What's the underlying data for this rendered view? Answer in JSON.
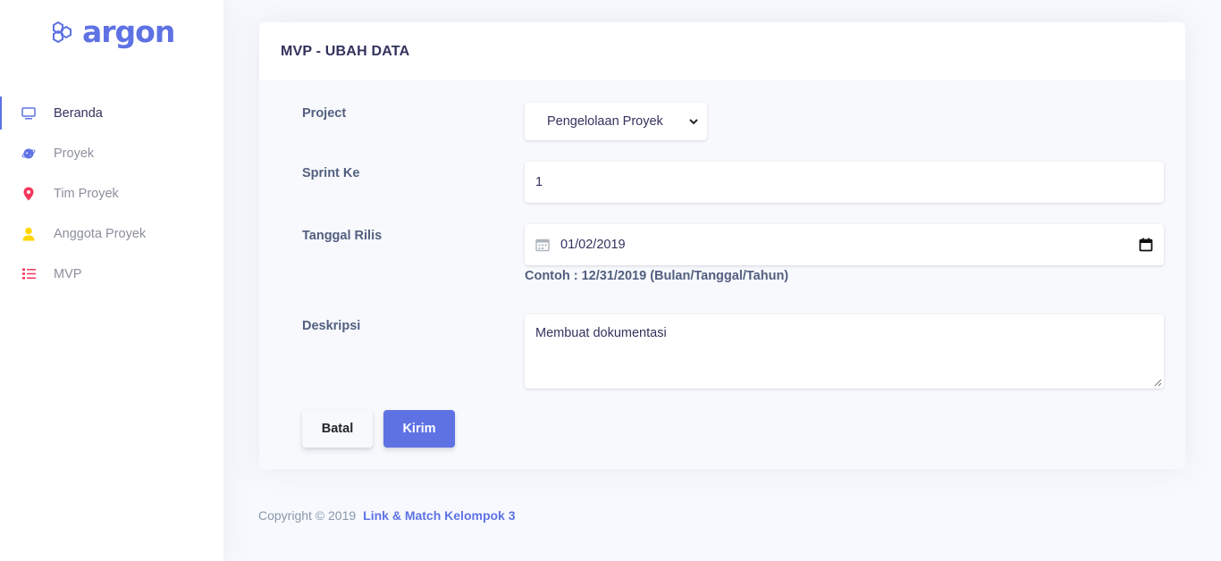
{
  "brand": {
    "name": "argon",
    "icon": "hexagons-logo-icon",
    "color": "#5e72e4"
  },
  "sidebar": {
    "items": [
      {
        "label": "Beranda",
        "icon": "monitor-icon",
        "color": "#5e72e4",
        "active": true
      },
      {
        "label": "Proyek",
        "icon": "planet-icon",
        "color": "#5e72e4",
        "active": false
      },
      {
        "label": "Tim Proyek",
        "icon": "pin-icon",
        "color": "#f5365c",
        "active": false
      },
      {
        "label": "Anggota Proyek",
        "icon": "user-icon",
        "color": "#ffd600",
        "active": false
      },
      {
        "label": "MVP",
        "icon": "list-icon",
        "color": "#f5365c",
        "active": false
      }
    ]
  },
  "card": {
    "title": "MVP - UBAH DATA",
    "form": {
      "project_label": "Project",
      "project_value": "Pengelolaan Proyek",
      "sprint_label": "Sprint Ke",
      "sprint_value": "1",
      "date_label": "Tanggal Rilis",
      "date_value": "01/02/2019",
      "date_hint": "Contoh : 12/31/2019 (Bulan/Tanggal/Tahun)",
      "desc_label": "Deskripsi",
      "desc_value": "Membuat dokumentasi"
    },
    "buttons": {
      "cancel": "Batal",
      "submit": "Kirim"
    }
  },
  "footer": {
    "copyright": "Copyright © 2019",
    "link": "Link & Match Kelompok 3"
  }
}
